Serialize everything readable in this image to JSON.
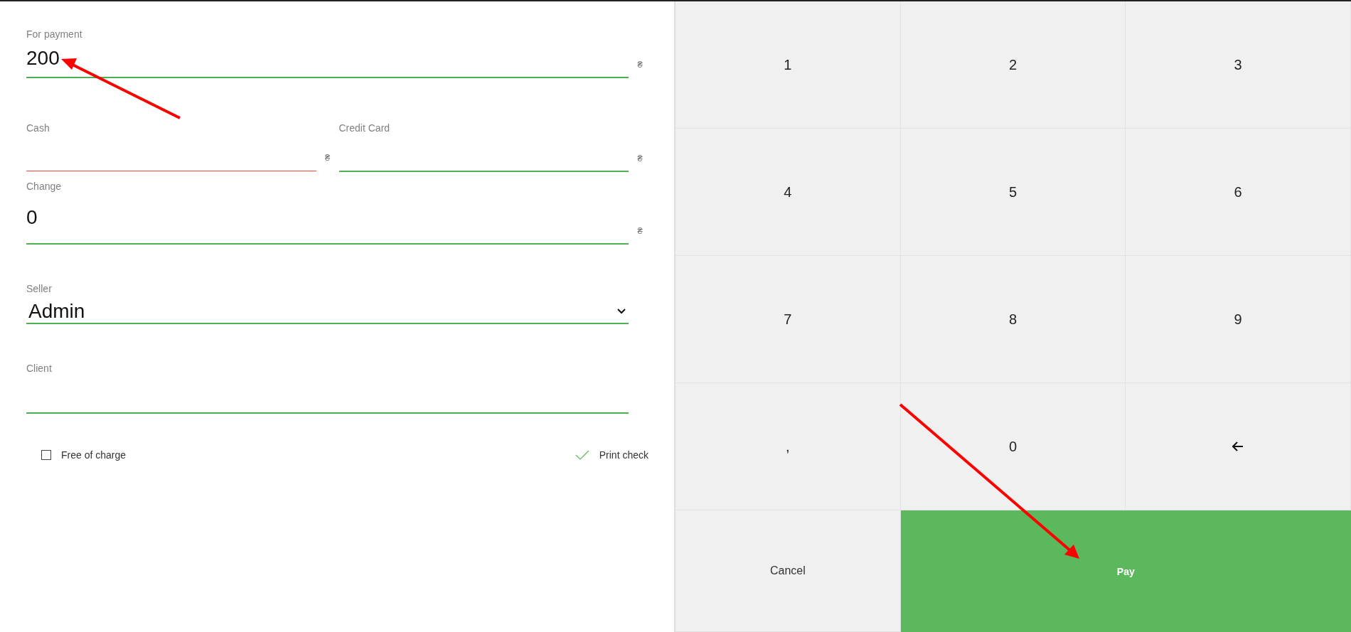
{
  "payment_form": {
    "for_payment": {
      "label": "For payment",
      "value": "200",
      "currency": "₴",
      "error": false
    },
    "cash": {
      "label": "Cash",
      "currency": "₴",
      "error": true
    },
    "credit_card": {
      "label": "Credit Card",
      "currency": "₴",
      "error": false
    },
    "change": {
      "label": "Change",
      "value": "0",
      "currency": "₴",
      "error": false
    },
    "seller": {
      "label": "Seller",
      "value": "Admin"
    },
    "client": {
      "label": "Client"
    },
    "options": [
      {
        "label": "Free of charge",
        "checked": false
      },
      {
        "label": "Print check",
        "checked": true
      }
    ]
  },
  "keypad": {
    "keys": [
      {
        "kind": "digit",
        "label": "1"
      },
      {
        "kind": "digit",
        "label": "2"
      },
      {
        "kind": "digit",
        "label": "3"
      },
      {
        "kind": "digit",
        "label": "4"
      },
      {
        "kind": "digit",
        "label": "5"
      },
      {
        "kind": "digit",
        "label": "6"
      },
      {
        "kind": "digit",
        "label": "7"
      },
      {
        "kind": "digit",
        "label": "8"
      },
      {
        "kind": "digit",
        "label": "9"
      },
      {
        "kind": "digit",
        "label": ","
      },
      {
        "kind": "digit",
        "label": "0"
      },
      {
        "kind": "backspace"
      }
    ],
    "cancel": "Cancel",
    "pay": "Pay"
  }
}
